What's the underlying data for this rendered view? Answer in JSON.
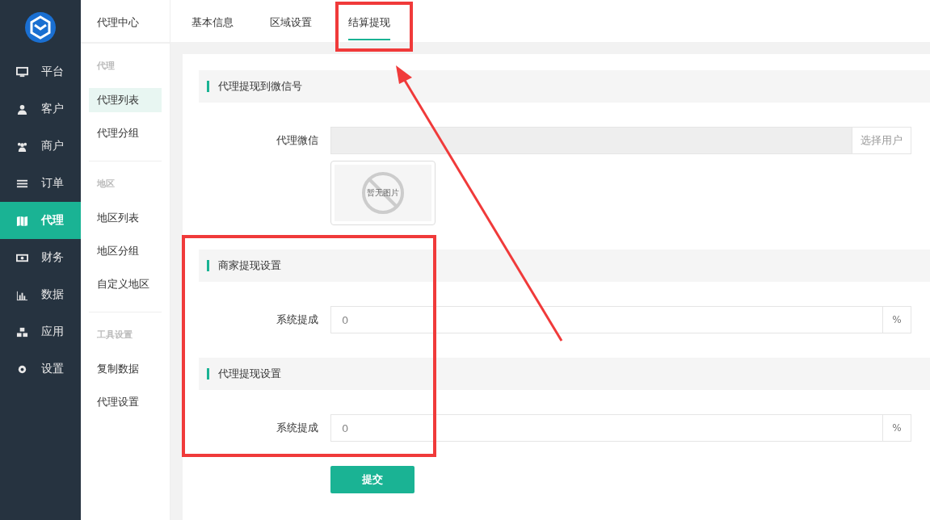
{
  "nav": [
    {
      "label": "平台",
      "selected": false
    },
    {
      "label": "客户",
      "selected": false
    },
    {
      "label": "商户",
      "selected": false
    },
    {
      "label": "订单",
      "selected": false
    },
    {
      "label": "代理",
      "selected": true
    },
    {
      "label": "财务",
      "selected": false
    },
    {
      "label": "数据",
      "selected": false
    },
    {
      "label": "应用",
      "selected": false
    },
    {
      "label": "设置",
      "selected": false
    }
  ],
  "subnav": {
    "title": "代理中心",
    "groups": [
      {
        "heading": "代理",
        "items": [
          {
            "label": "代理列表",
            "selected": true
          },
          {
            "label": "代理分组",
            "selected": false
          }
        ]
      },
      {
        "heading": "地区",
        "items": [
          {
            "label": "地区列表",
            "selected": false
          },
          {
            "label": "地区分组",
            "selected": false
          },
          {
            "label": "自定义地区",
            "selected": false
          }
        ]
      },
      {
        "heading": "工具设置",
        "items": [
          {
            "label": "复制数据",
            "selected": false
          },
          {
            "label": "代理设置",
            "selected": false
          }
        ]
      }
    ]
  },
  "tabs": [
    {
      "label": "基本信息",
      "selected": false
    },
    {
      "label": "区域设置",
      "selected": false
    },
    {
      "label": "结算提现",
      "selected": true
    }
  ],
  "sections": [
    {
      "title": "代理提现到微信号",
      "fields": [
        {
          "kind": "user",
          "label": "代理微信",
          "button": "选择用户",
          "image_text": "暂无图片"
        }
      ]
    },
    {
      "title": "商家提现设置",
      "fields": [
        {
          "kind": "percent",
          "label": "系统提成",
          "value": "0",
          "suffix": "%"
        }
      ]
    },
    {
      "title": "代理提现设置",
      "fields": [
        {
          "kind": "percent",
          "label": "系统提成",
          "value": "0",
          "suffix": "%"
        }
      ]
    }
  ],
  "submit": "提交"
}
